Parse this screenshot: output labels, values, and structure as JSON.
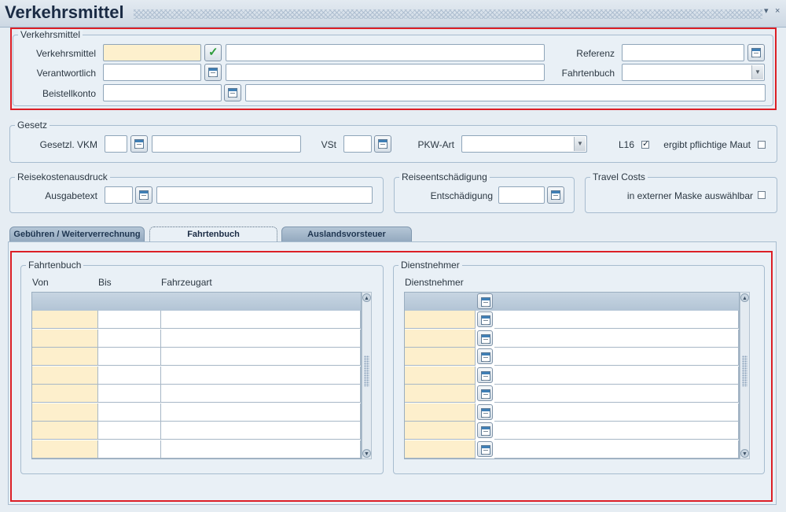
{
  "window": {
    "title": "Verkehrsmittel"
  },
  "header_section": {
    "legend": "Verkehrsmittel",
    "verkehrsmittel_label": "Verkehrsmittel",
    "verantwortlich_label": "Verantwortlich",
    "beistellkonto_label": "Beistellkonto",
    "referenz_label": "Referenz",
    "fahrtenbuch_label": "Fahrtenbuch"
  },
  "gesetz": {
    "legend": "Gesetz",
    "vkm_label": "Gesetzl. VKM",
    "vst_label": "VSt",
    "pkw_label": "PKW-Art",
    "l16_label": "L16",
    "l16_checked": true,
    "maut_label": "ergibt pflichtige Maut",
    "maut_checked": false
  },
  "reisekosten": {
    "legend": "Reisekostenausdruck",
    "ausgabetext_label": "Ausgabetext"
  },
  "reiseentschaedigung": {
    "legend": "Reiseentschädigung",
    "entschaedigung_label": "Entschädigung"
  },
  "travel_costs": {
    "legend": "Travel Costs",
    "extern_label": "in externer Maske auswählbar",
    "extern_checked": false
  },
  "tabs": [
    {
      "label": "Gebühren / Weiterverrechnung",
      "active": false
    },
    {
      "label": "Fahrtenbuch",
      "active": true
    },
    {
      "label": "Auslandsvorsteuer",
      "active": false
    }
  ],
  "fahrtenbuch_table": {
    "legend": "Fahrtenbuch",
    "columns": [
      "Von",
      "Bis",
      "Fahrzeugart"
    ],
    "row_count": 8
  },
  "dienstnehmer_table": {
    "legend": "Dienstnehmer",
    "columns": [
      "Dienstnehmer"
    ],
    "row_count": 8
  }
}
